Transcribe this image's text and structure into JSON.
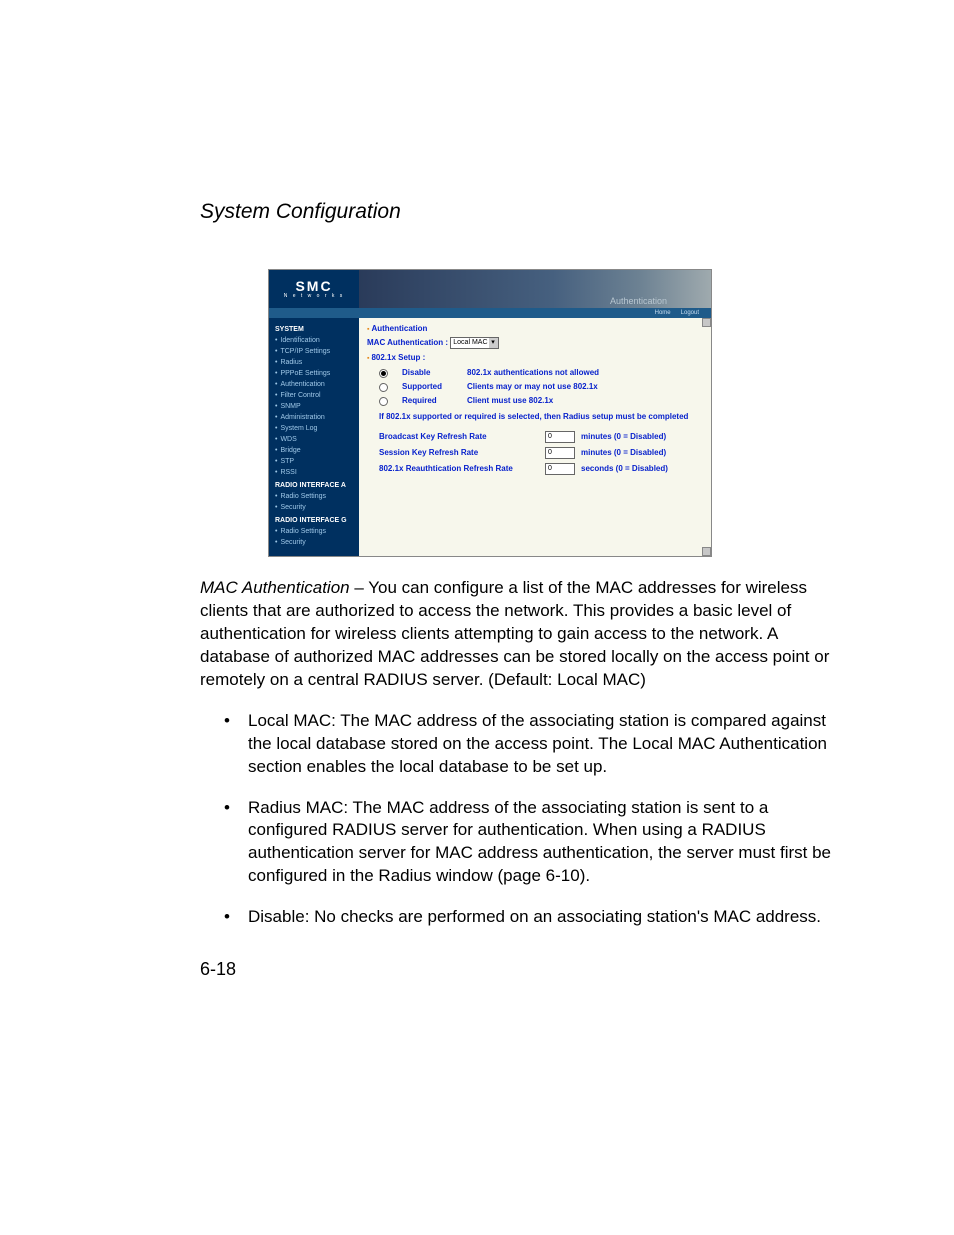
{
  "page_heading": "System Configuration",
  "page_number": "6-18",
  "shot": {
    "brand": "SMC",
    "brand_sub": "N e t w o r k s",
    "banner_text": "Authentication",
    "toolbar": {
      "home": "Home",
      "logout": "Logout"
    },
    "nav": {
      "system_head": "SYSTEM",
      "system_items": [
        "Identification",
        "TCP/IP Settings",
        "Radius",
        "PPPoE Settings",
        "Authentication",
        "Filter Control",
        "SNMP",
        "Administration",
        "System Log",
        "WDS",
        "Bridge",
        "STP",
        "RSSI"
      ],
      "ria_head": "RADIO INTERFACE A",
      "ria_items": [
        "Radio Settings",
        "Security"
      ],
      "rig_head": "RADIO INTERFACE G",
      "rig_items": [
        "Radio Settings",
        "Security"
      ]
    },
    "content": {
      "auth_title": "Authentication",
      "mac_auth_label": "MAC Authentication :",
      "mac_auth_value": "Local MAC",
      "setup_title": "802.1x Setup :",
      "options": [
        {
          "label": "Disable",
          "desc": "802.1x authentications not allowed",
          "selected": true
        },
        {
          "label": "Supported",
          "desc": "Clients may or may not use 802.1x",
          "selected": false
        },
        {
          "label": "Required",
          "desc": "Client must use 802.1x",
          "selected": false
        }
      ],
      "radius_note": "If 802.1x supported or required is selected, then Radius setup must be completed",
      "rates": [
        {
          "label": "Broadcast Key Refresh Rate",
          "value": "0",
          "unit": "minutes  (0 = Disabled)"
        },
        {
          "label": "Session Key Refresh Rate",
          "value": "0",
          "unit": "minutes  (0 = Disabled)"
        },
        {
          "label": "802.1x Reauthtication Refresh Rate",
          "value": "0",
          "unit": "seconds  (0 = Disabled)"
        }
      ]
    }
  },
  "body": {
    "lead_label": "MAC Authentication",
    "lead_text": " – You can configure a list of the MAC addresses for wireless clients that are authorized to access the network. This provides a basic level of authentication for wireless clients attempting to gain access to the network. A database of authorized MAC addresses can be stored locally on the access point or remotely on a central RADIUS server. (Default: Local MAC)",
    "bullets": [
      "Local MAC: The MAC address of the associating station is compared against the local database stored on the access point. The Local MAC Authentication section enables the local database to be set up.",
      "Radius MAC: The MAC address of the associating station is sent to a configured RADIUS server for authentication. When using a RADIUS authentication server for MAC address authentication, the server must first be configured in the Radius window (page 6-10).",
      "Disable: No checks are performed on an associating station's MAC address."
    ]
  }
}
